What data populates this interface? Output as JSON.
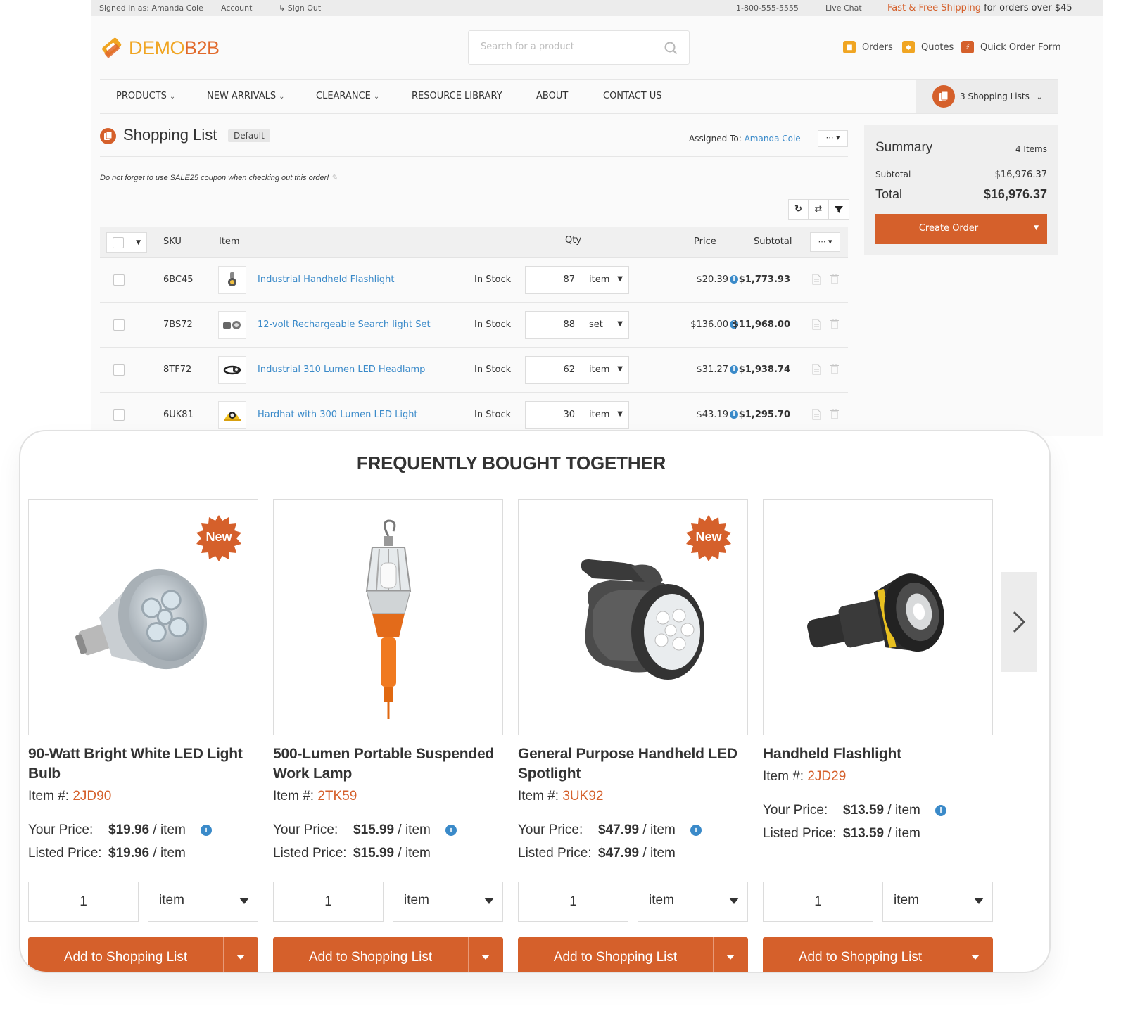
{
  "topbar": {
    "signed_in": "Signed in as: Amanda Cole",
    "account": "Account",
    "sign_out": "Sign Out",
    "phone": "1-800-555-5555",
    "live_chat": "Live Chat",
    "shipping_accent": "Fast & Free Shipping",
    "shipping_rest": "for orders over $45"
  },
  "logo": {
    "part1": "DEMO",
    "part2": "B2B"
  },
  "search": {
    "placeholder": "Search for a product"
  },
  "quicklinks": {
    "orders": "Orders",
    "quotes": "Quotes",
    "quick_order": "Quick Order Form"
  },
  "nav": {
    "products": "PRODUCTS",
    "new_arrivals": "NEW ARRIVALS",
    "clearance": "CLEARANCE",
    "resource_library": "RESOURCE LIBRARY",
    "about": "ABOUT",
    "contact": "CONTACT US",
    "shopping_lists": "3 Shopping Lists"
  },
  "shopping_list": {
    "title": "Shopping List",
    "badge": "Default",
    "assigned_label": "Assigned To:",
    "assigned_name": "Amanda Cole",
    "more": "⋯",
    "note": "Do not forget to use SALE25 coupon when checking out this order!",
    "columns": {
      "sku": "SKU",
      "item": "Item",
      "qty": "Qty",
      "price": "Price",
      "subtotal": "Subtotal"
    },
    "rows": [
      {
        "sku": "6BC45",
        "name": "Industrial Handheld Flashlight",
        "stock": "In Stock",
        "qty": "87",
        "unit": "item",
        "price": "$20.39",
        "subtotal": "$1,773.93"
      },
      {
        "sku": "7BS72",
        "name": "12-volt Rechargeable Search light Set",
        "stock": "In Stock",
        "qty": "88",
        "unit": "set",
        "price": "$136.00",
        "subtotal": "$11,968.00"
      },
      {
        "sku": "8TF72",
        "name": "Industrial 310 Lumen LED Headlamp",
        "stock": "In Stock",
        "qty": "62",
        "unit": "item",
        "price": "$31.27",
        "subtotal": "$1,938.74"
      },
      {
        "sku": "6UK81",
        "name": "Hardhat with 300 Lumen LED Light",
        "stock": "In Stock",
        "qty": "30",
        "unit": "item",
        "price": "$43.19",
        "subtotal": "$1,295.70"
      }
    ]
  },
  "summary": {
    "title": "Summary",
    "count": "4 Items",
    "subtotal_label": "Subtotal",
    "subtotal_value": "$16,976.37",
    "total_label": "Total",
    "total_value": "$16,976.37",
    "create_order": "Create Order"
  },
  "fbt": {
    "title": "FREQUENTLY BOUGHT TOGETHER",
    "badge_new": "New",
    "item_label": "Item #:",
    "your_price_label": "Your Price:",
    "listed_price_label": "Listed Price:",
    "per_item": "/ item",
    "add_label": "Add to Shopping List",
    "products": [
      {
        "name": "90-Watt Bright White LED Light Bulb",
        "item_no": "2JD90",
        "your_price": "$19.96",
        "listed_price": "$19.96",
        "qty": "1",
        "unit": "item"
      },
      {
        "name": "500-Lumen Portable Suspended Work Lamp",
        "item_no": "2TK59",
        "your_price": "$15.99",
        "listed_price": "$15.99",
        "qty": "1",
        "unit": "item"
      },
      {
        "name": "General Purpose Handheld LED Spotlight",
        "item_no": "3UK92",
        "your_price": "$47.99",
        "listed_price": "$47.99",
        "qty": "1",
        "unit": "item"
      },
      {
        "name": "Handheld Flashlight",
        "item_no": "2JD29",
        "your_price": "$13.59",
        "listed_price": "$13.59",
        "qty": "1",
        "unit": "item"
      }
    ]
  },
  "colors": {
    "accent": "#d5602b",
    "link": "#3a8ac9",
    "logo_yellow": "#f0a522"
  }
}
